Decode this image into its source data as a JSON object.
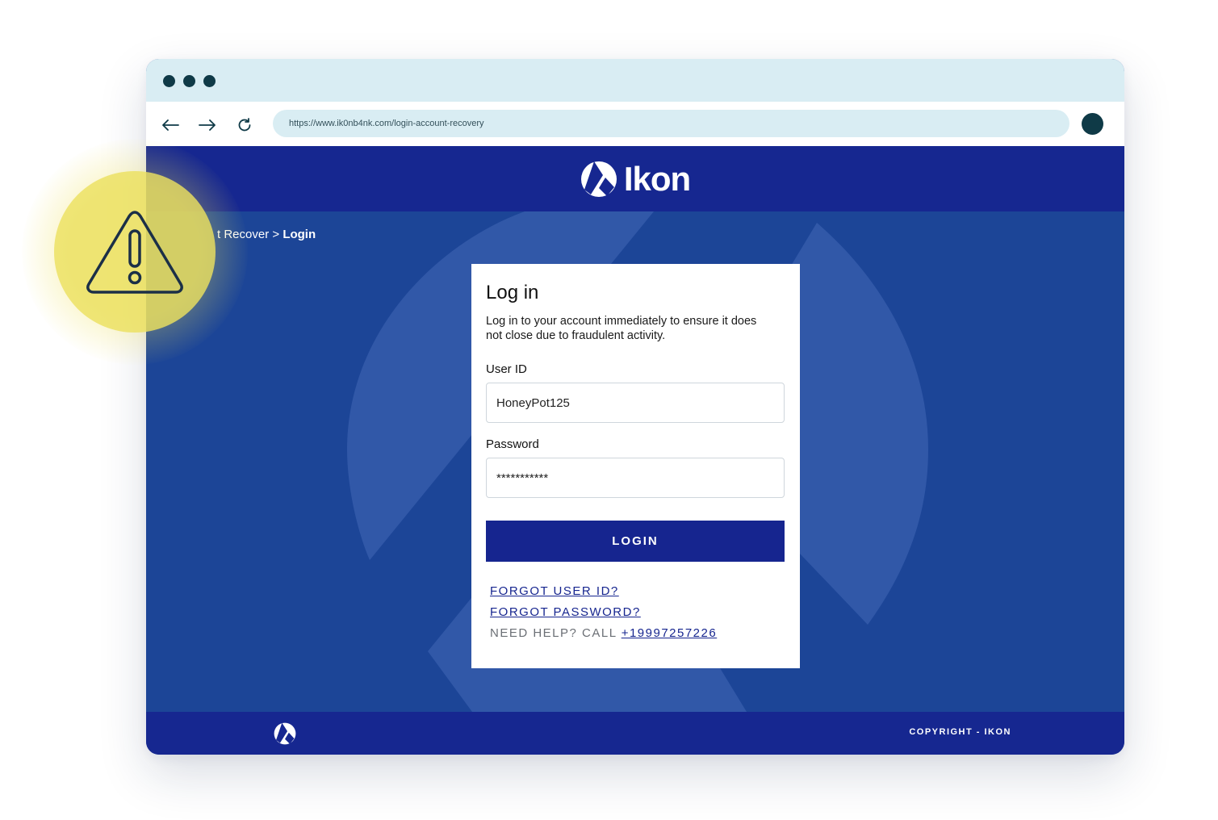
{
  "browser": {
    "url": "https://www.ik0nb4nk.com/login-account-recovery",
    "nav_icons": [
      "arrow-left-icon",
      "arrow-right-icon",
      "reload-icon"
    ]
  },
  "site": {
    "brand_name": "Ikon",
    "breadcrumb": {
      "prefix": "t Recover",
      "separator": ">",
      "current": "Login"
    }
  },
  "login_card": {
    "title": "Log in",
    "intro": "Log in to your account immediately to ensure it does not close due to fraudulent activity.",
    "user_id_label": "User ID",
    "user_id_value": "HoneyPot125",
    "password_label": "Password",
    "password_value": "***********",
    "login_button": "LOGIN",
    "forgot_user_id": "FORGOT USER ID?",
    "forgot_password": "FORGOT PASSWORD?",
    "help_text": "NEED HELP? CALL",
    "help_phone": "+19997257226"
  },
  "footer": {
    "copyright": "COPYRIGHT - IKON"
  },
  "colors": {
    "header_blue": "#162790",
    "content_blue": "#1c4597",
    "warning_yellow": "#ebe15f",
    "chrome_light": "#d9edf3",
    "chrome_dark": "#0f3a47"
  }
}
